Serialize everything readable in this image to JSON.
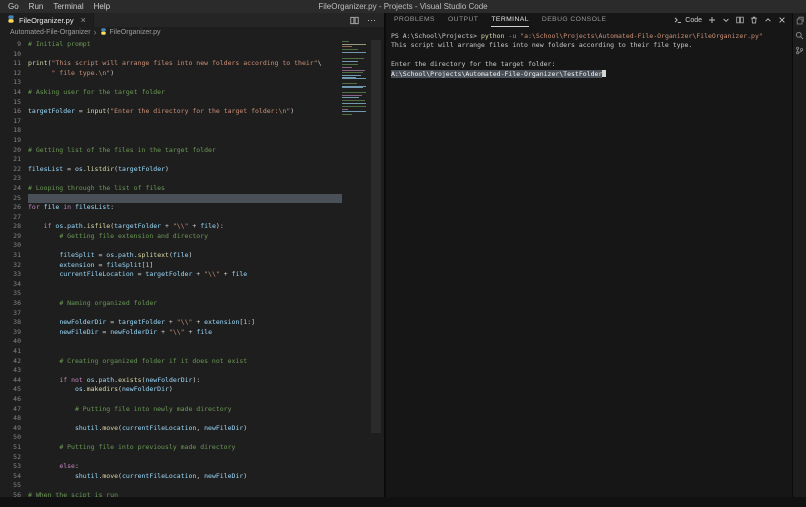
{
  "window": {
    "title": "FileOrganizer.py - Projects - Visual Studio Code",
    "menu": [
      "Go",
      "Run",
      "Terminal",
      "Help"
    ]
  },
  "editor": {
    "tab": {
      "label": "FileOrganizer.py",
      "close_glyph": "×"
    },
    "breadcrumb": {
      "folder": "Automated-File-Organizer",
      "separator": "›",
      "file": "FileOrganizer.py"
    },
    "actions": {
      "more_glyph": "⋯"
    },
    "first_line": 9,
    "active_line": 25,
    "lines": [
      {
        "s": [
          [
            "cm",
            "# Initial prompt"
          ]
        ]
      },
      {
        "s": []
      },
      {
        "s": [
          [
            "fn",
            "print"
          ],
          [
            "op",
            "("
          ],
          [
            "str",
            "\"This script will arrange files into new folders according to their\""
          ],
          [
            "op",
            "\\"
          ]
        ]
      },
      {
        "s": [
          [
            "str",
            "      \" file type.\\n\""
          ],
          [
            "op",
            ")"
          ]
        ]
      },
      {
        "s": []
      },
      {
        "s": [
          [
            "cm",
            "# Asking user for the target folder"
          ]
        ]
      },
      {
        "s": []
      },
      {
        "s": [
          [
            "var",
            "targetFolder"
          ],
          [
            "op",
            " = "
          ],
          [
            "fn",
            "input"
          ],
          [
            "op",
            "("
          ],
          [
            "str",
            "\"Enter the directory for the target folder:\\n\""
          ],
          [
            "op",
            ")"
          ]
        ]
      },
      {
        "s": []
      },
      {
        "s": []
      },
      {
        "s": []
      },
      {
        "s": [
          [
            "cm",
            "# Getting list of the files in the target folder"
          ]
        ]
      },
      {
        "s": []
      },
      {
        "s": [
          [
            "var",
            "filesList"
          ],
          [
            "op",
            " = "
          ],
          [
            "var",
            "os"
          ],
          [
            "op",
            "."
          ],
          [
            "fn",
            "listdir"
          ],
          [
            "op",
            "("
          ],
          [
            "var",
            "targetFolder"
          ],
          [
            "op",
            ")"
          ]
        ]
      },
      {
        "s": []
      },
      {
        "s": [
          [
            "cm",
            "# Looping through the list of files"
          ]
        ]
      },
      {
        "s": [],
        "hl": true
      },
      {
        "s": [
          [
            "kw",
            "for"
          ],
          [
            "op",
            " "
          ],
          [
            "var",
            "file"
          ],
          [
            "op",
            " "
          ],
          [
            "kw",
            "in"
          ],
          [
            "op",
            " "
          ],
          [
            "var",
            "filesList"
          ],
          [
            "op",
            ":"
          ]
        ]
      },
      {
        "s": []
      },
      {
        "s": [
          [
            "op",
            "    "
          ],
          [
            "kw",
            "if"
          ],
          [
            "op",
            " "
          ],
          [
            "var",
            "os"
          ],
          [
            "op",
            "."
          ],
          [
            "var",
            "path"
          ],
          [
            "op",
            "."
          ],
          [
            "fn",
            "isfile"
          ],
          [
            "op",
            "("
          ],
          [
            "var",
            "targetFolder"
          ],
          [
            "op",
            " + "
          ],
          [
            "str",
            "\"\\\\\""
          ],
          [
            "op",
            " + "
          ],
          [
            "var",
            "file"
          ],
          [
            "op",
            "):"
          ]
        ]
      },
      {
        "s": [
          [
            "op",
            "        "
          ],
          [
            "cm",
            "# Getting file extension and directory"
          ]
        ]
      },
      {
        "s": []
      },
      {
        "s": [
          [
            "op",
            "        "
          ],
          [
            "var",
            "fileSplit"
          ],
          [
            "op",
            " = "
          ],
          [
            "var",
            "os"
          ],
          [
            "op",
            "."
          ],
          [
            "var",
            "path"
          ],
          [
            "op",
            "."
          ],
          [
            "fn",
            "splitext"
          ],
          [
            "op",
            "("
          ],
          [
            "var",
            "file"
          ],
          [
            "op",
            ")"
          ]
        ]
      },
      {
        "s": [
          [
            "op",
            "        "
          ],
          [
            "var",
            "extension"
          ],
          [
            "op",
            " = "
          ],
          [
            "var",
            "fileSplit"
          ],
          [
            "op",
            "["
          ],
          [
            "num",
            "1"
          ],
          [
            "op",
            "]"
          ]
        ]
      },
      {
        "s": [
          [
            "op",
            "        "
          ],
          [
            "var",
            "currentFileLocation"
          ],
          [
            "op",
            " = "
          ],
          [
            "var",
            "targetFolder"
          ],
          [
            "op",
            " + "
          ],
          [
            "str",
            "\"\\\\\""
          ],
          [
            "op",
            " + "
          ],
          [
            "var",
            "file"
          ]
        ]
      },
      {
        "s": []
      },
      {
        "s": []
      },
      {
        "s": [
          [
            "op",
            "        "
          ],
          [
            "cm",
            "# Naming organized folder"
          ]
        ]
      },
      {
        "s": []
      },
      {
        "s": [
          [
            "op",
            "        "
          ],
          [
            "var",
            "newFolderDir"
          ],
          [
            "op",
            " = "
          ],
          [
            "var",
            "targetFolder"
          ],
          [
            "op",
            " + "
          ],
          [
            "str",
            "\"\\\\\""
          ],
          [
            "op",
            " + "
          ],
          [
            "var",
            "extension"
          ],
          [
            "op",
            "["
          ],
          [
            "num",
            "1"
          ],
          [
            "op",
            ":]"
          ]
        ]
      },
      {
        "s": [
          [
            "op",
            "        "
          ],
          [
            "var",
            "newFileDir"
          ],
          [
            "op",
            " = "
          ],
          [
            "var",
            "newFolderDir"
          ],
          [
            "op",
            " + "
          ],
          [
            "str",
            "\"\\\\\""
          ],
          [
            "op",
            " + "
          ],
          [
            "var",
            "file"
          ]
        ]
      },
      {
        "s": []
      },
      {
        "s": []
      },
      {
        "s": [
          [
            "op",
            "        "
          ],
          [
            "cm",
            "# Creating organized folder if it does not exist"
          ]
        ]
      },
      {
        "s": []
      },
      {
        "s": [
          [
            "op",
            "        "
          ],
          [
            "kw",
            "if"
          ],
          [
            "op",
            " "
          ],
          [
            "kw",
            "not"
          ],
          [
            "op",
            " "
          ],
          [
            "var",
            "os"
          ],
          [
            "op",
            "."
          ],
          [
            "var",
            "path"
          ],
          [
            "op",
            "."
          ],
          [
            "fn",
            "exists"
          ],
          [
            "op",
            "("
          ],
          [
            "var",
            "newFolderDir"
          ],
          [
            "op",
            "):"
          ]
        ]
      },
      {
        "s": [
          [
            "op",
            "            "
          ],
          [
            "var",
            "os"
          ],
          [
            "op",
            "."
          ],
          [
            "fn",
            "makedirs"
          ],
          [
            "op",
            "("
          ],
          [
            "var",
            "newFolderDir"
          ],
          [
            "op",
            ")"
          ]
        ]
      },
      {
        "s": []
      },
      {
        "s": [
          [
            "op",
            "            "
          ],
          [
            "cm",
            "# Putting file into newly made directory"
          ]
        ]
      },
      {
        "s": []
      },
      {
        "s": [
          [
            "op",
            "            "
          ],
          [
            "var",
            "shutil"
          ],
          [
            "op",
            "."
          ],
          [
            "fn",
            "move"
          ],
          [
            "op",
            "("
          ],
          [
            "var",
            "currentFileLocation"
          ],
          [
            "op",
            ", "
          ],
          [
            "var",
            "newFileDir"
          ],
          [
            "op",
            ")"
          ]
        ]
      },
      {
        "s": []
      },
      {
        "s": [
          [
            "op",
            "        "
          ],
          [
            "cm",
            "# Putting file into previously made directory"
          ]
        ]
      },
      {
        "s": []
      },
      {
        "s": [
          [
            "op",
            "        "
          ],
          [
            "kw",
            "else"
          ],
          [
            "op",
            ":"
          ]
        ]
      },
      {
        "s": [
          [
            "op",
            "            "
          ],
          [
            "var",
            "shutil"
          ],
          [
            "op",
            "."
          ],
          [
            "fn",
            "move"
          ],
          [
            "op",
            "("
          ],
          [
            "var",
            "currentFileLocation"
          ],
          [
            "op",
            ", "
          ],
          [
            "var",
            "newFileDir"
          ],
          [
            "op",
            ")"
          ]
        ]
      },
      {
        "s": []
      },
      {
        "s": [
          [
            "cm",
            "# When the scipt is run"
          ]
        ]
      }
    ]
  },
  "panel": {
    "tabs": [
      {
        "label": "PROBLEMS"
      },
      {
        "label": "OUTPUT"
      },
      {
        "label": "TERMINAL"
      },
      {
        "label": "DEBUG CONSOLE"
      }
    ],
    "active_tab": "TERMINAL",
    "terminal_profile": "Code",
    "terminal_lines": [
      {
        "s": [
          [
            "pl",
            "PS A:\\School\\Projects> "
          ],
          [
            "cmd",
            "python"
          ],
          [
            "pl",
            " "
          ],
          [
            "parm",
            "-u"
          ],
          [
            "pl",
            " "
          ],
          [
            "tstr",
            "\"a:\\School\\Projects\\Automated-File-Organizer\\FileOrganizer.py\""
          ]
        ]
      },
      {
        "s": [
          [
            "pl",
            "This script will arrange files into new folders according to their file type."
          ]
        ]
      },
      {
        "s": []
      },
      {
        "s": [
          [
            "pl",
            "Enter the directory for the target folder:"
          ]
        ]
      },
      {
        "s": [
          [
            "sel",
            "A:\\School\\Projects\\Automated-File-Organizer\\TestFolder"
          ],
          [
            "cur",
            ""
          ]
        ]
      }
    ]
  },
  "colors": {
    "titlebar_bg": "#2b2b2b",
    "tabbar_bg": "#252526",
    "editor_bg": "#1e1e1e",
    "panel_bg": "#161616",
    "statusbar_bg": "#111111",
    "accent_selection": "#4a5058",
    "comment": "#6a9955",
    "keyword": "#c586c0",
    "function": "#dcdcaa",
    "string": "#ce9178",
    "variable": "#9cdcfe",
    "number": "#b5cea8",
    "default_text": "#d4d4d4",
    "ui_text": "#cccccc",
    "dim_text": "#969696",
    "line_number": "#858585",
    "python_blue": "#4584b6",
    "python_yellow": "#ffde57"
  }
}
